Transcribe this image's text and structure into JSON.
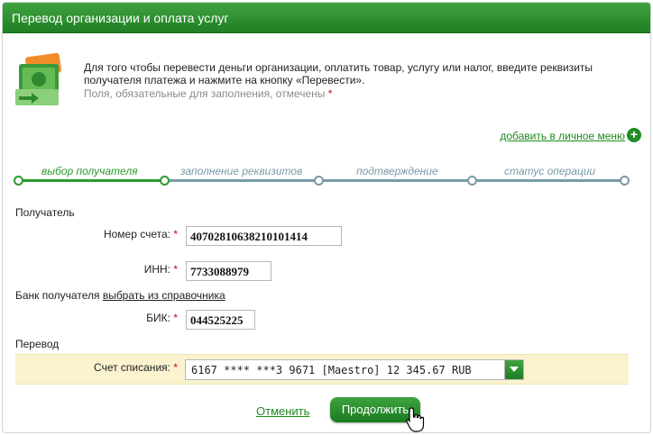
{
  "header": {
    "title": "Перевод организации и оплата услуг"
  },
  "intro": {
    "text": "Для того чтобы перевести деньги организации, оплатить товар, услугу или налог, введите реквизиты получателя платежа и нажмите на кнопку «Перевести».",
    "note": "Поля, обязательные для заполнения, отмечены",
    "required_mark": "*"
  },
  "add_menu_link": "добавить в личное меню",
  "steps": [
    {
      "label": "выбор получателя",
      "active": true
    },
    {
      "label": "заполнение реквизитов",
      "active": false
    },
    {
      "label": "подтверждение",
      "active": false
    },
    {
      "label": "статус операции",
      "active": false
    }
  ],
  "recipient": {
    "section_label": "Получатель",
    "account_label": "Номер счета:",
    "account_value": "40702810638210101414",
    "inn_label": "ИНН:",
    "inn_value": "7733088979"
  },
  "bank": {
    "section_label": "Банк получателя",
    "directory_link": "выбрать из справочника",
    "bik_label": "БИК:",
    "bik_value": "044525225"
  },
  "transfer": {
    "section_label": "Перевод",
    "debit_label": "Счет списания:",
    "debit_value": "6167 **** ***3 9671 [Maestro] 12 345.67 RUB"
  },
  "actions": {
    "cancel": "Отменить",
    "continue": "Продолжить"
  },
  "colors": {
    "accent": "#1f7f24",
    "link": "#1e8a1e",
    "required": "#d40000",
    "highlight_row": "#fbf3cf",
    "inactive_step": "#7a9aa8"
  }
}
